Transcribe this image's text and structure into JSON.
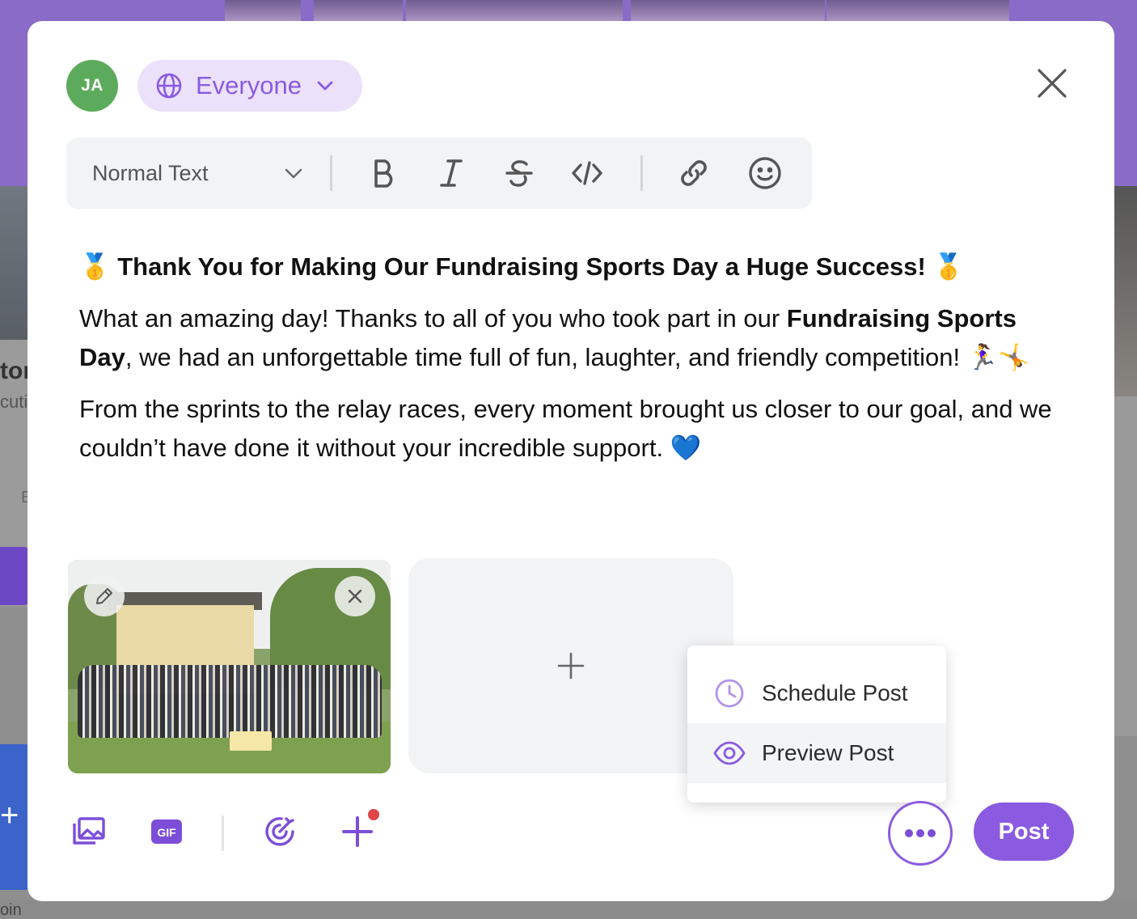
{
  "composer": {
    "avatar_initials": "JA",
    "avatar_color": "#5cab5c",
    "audience_label": "Everyone",
    "accent_color": "#8a5be0",
    "toolbar": {
      "text_style": "Normal Text",
      "buttons": [
        "bold-icon",
        "italic-icon",
        "strikethrough-icon",
        "code-icon",
        "link-icon",
        "emoji-icon"
      ]
    },
    "body": {
      "headline": "🥇 Thank You for Making Our Fundraising Sports Day a Huge Success! 🥇",
      "para1_start": "What an amazing day! Thanks to all of you who took part in our ",
      "para1_bold": "Fundraising Sports Day",
      "para1_end": ", we had an unforgettable time full of fun, laughter, and friendly competition! 🏃‍♀️🤸",
      "para2": "From the sprints to the relay races, every moment brought us closer to our goal, and we couldn’t have done it without your incredible support. 💙"
    },
    "bottom_actions": [
      "gallery-icon",
      "gif-icon",
      "target-icon",
      "plus-icon"
    ],
    "gif_label": "GIF",
    "post_label": "Post"
  },
  "more_menu": {
    "items": [
      {
        "label": "Schedule Post",
        "icon": "clock-icon"
      },
      {
        "label": "Preview Post",
        "icon": "eye-icon"
      }
    ]
  },
  "background": {
    "left_card_title": "tor",
    "left_card_sub": "cuti",
    "left_card_small": "E",
    "bottom_text": "oin"
  }
}
